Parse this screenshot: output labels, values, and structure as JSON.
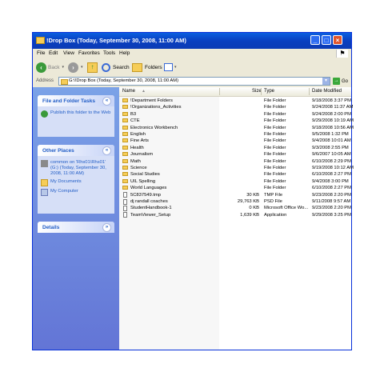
{
  "window": {
    "title": "!Drop Box (Today, September 30, 2008, 11:00 AM)",
    "minimize": "_",
    "maximize": "□",
    "close": "×"
  },
  "menu": [
    "File",
    "Edit",
    "View",
    "Favorites",
    "Tools",
    "Help"
  ],
  "toolbar": {
    "back": "Back",
    "search": "Search",
    "folders": "Folders"
  },
  "address": {
    "label": "Address",
    "value": "G:\\!Drop Box (Today, September 30, 2008, 11:00 AM)",
    "go": "Go"
  },
  "tasks": {
    "file_folder_title": "File and Folder Tasks",
    "publish": "Publish this folder to the Web",
    "other_places_title": "Other Places",
    "common": "common on 'Rhs01\\Rhs01' (G:) (Today, September 30, 2008, 11:00 AM)",
    "my_documents": "My Documents",
    "my_computer": "My Computer",
    "details_title": "Details"
  },
  "columns": {
    "name": "Name",
    "size": "Size",
    "type": "Type",
    "date": "Date Modified"
  },
  "files": [
    {
      "name": "!Department Folders",
      "size": "",
      "type": "File Folder",
      "date": "9/18/2008 3:37 PM",
      "kind": "folder"
    },
    {
      "name": "!Organizations_Activities",
      "size": "",
      "type": "File Folder",
      "date": "9/24/2008 11:37 AM",
      "kind": "folder"
    },
    {
      "name": "B3",
      "size": "",
      "type": "File Folder",
      "date": "9/24/2008 2:00 PM",
      "kind": "folder"
    },
    {
      "name": "CTE",
      "size": "",
      "type": "File Folder",
      "date": "9/29/2008 10:19 AM",
      "kind": "folder"
    },
    {
      "name": "Electronics Workbench",
      "size": "",
      "type": "File Folder",
      "date": "9/18/2008 10:56 AM",
      "kind": "folder"
    },
    {
      "name": "English",
      "size": "",
      "type": "File Folder",
      "date": "9/5/2008 1:32 PM",
      "kind": "folder"
    },
    {
      "name": "Fine Arts",
      "size": "",
      "type": "File Folder",
      "date": "9/4/2008 10:01 AM",
      "kind": "folder"
    },
    {
      "name": "Health",
      "size": "",
      "type": "File Folder",
      "date": "9/3/2008 2:55 PM",
      "kind": "folder"
    },
    {
      "name": "Journalism",
      "size": "",
      "type": "File Folder",
      "date": "9/6/2007 10:05 AM",
      "kind": "folder"
    },
    {
      "name": "Math",
      "size": "",
      "type": "File Folder",
      "date": "6/10/2008 2:29 PM",
      "kind": "folder"
    },
    {
      "name": "Science",
      "size": "",
      "type": "File Folder",
      "date": "9/19/2008 10:12 AM",
      "kind": "folder"
    },
    {
      "name": "Social Studies",
      "size": "",
      "type": "File Folder",
      "date": "6/10/2008 2:27 PM",
      "kind": "folder"
    },
    {
      "name": "UIL Spelling",
      "size": "",
      "type": "File Folder",
      "date": "9/4/2008 3:00 PM",
      "kind": "folder"
    },
    {
      "name": "World Languages",
      "size": "",
      "type": "File Folder",
      "date": "6/10/2008 2:27 PM",
      "kind": "folder"
    },
    {
      "name": "5C837549.tmp",
      "size": "30 KB",
      "type": "TMP File",
      "date": "9/23/2008 2:20 PM",
      "kind": "file"
    },
    {
      "name": "dj randall coaches",
      "size": "29,763 KB",
      "type": "PSD File",
      "date": "9/11/2008 9:57 AM",
      "kind": "file"
    },
    {
      "name": "StudentHandbook-1",
      "size": "0 KB",
      "type": "Microsoft Office Wo...",
      "date": "9/23/2008 2:20 PM",
      "kind": "file"
    },
    {
      "name": "TeamViewer_Setup",
      "size": "1,639 KB",
      "type": "Application",
      "date": "9/29/2008 3:25 PM",
      "kind": "file"
    }
  ]
}
